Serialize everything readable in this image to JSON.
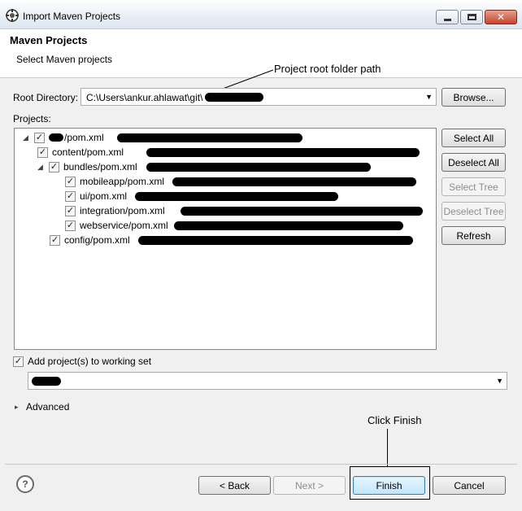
{
  "window": {
    "title": "Import Maven Projects"
  },
  "header": {
    "title": "Maven Projects",
    "subtitle": "Select Maven projects"
  },
  "annotations": {
    "root_path": "Project root folder path",
    "finish": "Click Finish"
  },
  "root": {
    "label": "Root Directory:",
    "value": "C:\\Users\\ankur.ahlawat\\git\\"
  },
  "projects_label": "Projects:",
  "tree": [
    {
      "label": "/pom.xml",
      "checked": true
    },
    {
      "label": "content/pom.xml",
      "checked": true
    },
    {
      "label": "bundles/pom.xml",
      "checked": true
    },
    {
      "label": "mobileapp/pom.xml",
      "checked": true
    },
    {
      "label": "ui/pom.xml",
      "checked": true
    },
    {
      "label": "integration/pom.xml",
      "checked": true
    },
    {
      "label": "webservice/pom.xml",
      "checked": true
    },
    {
      "label": "config/pom.xml",
      "checked": true
    }
  ],
  "side_buttons": {
    "browse": "Browse...",
    "select_all": "Select All",
    "deselect_all": "Deselect All",
    "select_tree": "Select Tree",
    "deselect_tree": "Deselect Tree",
    "refresh": "Refresh"
  },
  "working_set": {
    "label": "Add project(s) to working set",
    "checked": true
  },
  "advanced": "Advanced",
  "footer": {
    "back": "< Back",
    "next": "Next >",
    "finish": "Finish",
    "cancel": "Cancel",
    "help": "?"
  }
}
